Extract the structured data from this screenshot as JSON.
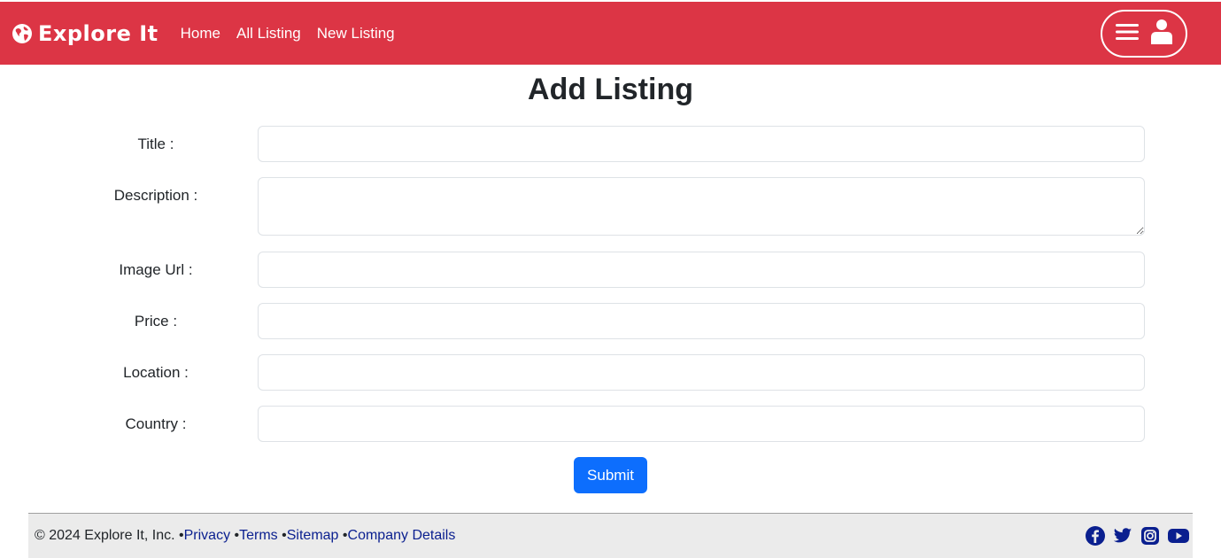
{
  "navbar": {
    "brand": "Explore It",
    "links": [
      "Home",
      "All Listing",
      "New Listing"
    ],
    "bg_color": "#dc3545",
    "icons": [
      "globe-icon",
      "menu-icon",
      "user-icon"
    ]
  },
  "page": {
    "title": "Add Listing"
  },
  "form": {
    "fields": [
      {
        "label": "Title :",
        "value": "",
        "placeholder": ""
      },
      {
        "label": "Description :",
        "value": "",
        "placeholder": ""
      },
      {
        "label": "Image Url :",
        "value": "",
        "placeholder": ""
      },
      {
        "label": "Price :",
        "value": "",
        "placeholder": ""
      },
      {
        "label": "Location :",
        "value": "",
        "placeholder": ""
      },
      {
        "label": "Country :",
        "value": "",
        "placeholder": ""
      }
    ],
    "submit_label": "Submit",
    "submit_color": "#0d6efd"
  },
  "footer": {
    "copyright": "© 2024 Explore It, Inc.",
    "links": [
      "Privacy",
      "Terms",
      "Sitemap",
      "Company Details"
    ],
    "separator": " •",
    "social_icons": [
      "facebook-icon",
      "twitter-icon",
      "instagram-icon",
      "youtube-icon"
    ],
    "link_color": "#0a1f8f"
  }
}
